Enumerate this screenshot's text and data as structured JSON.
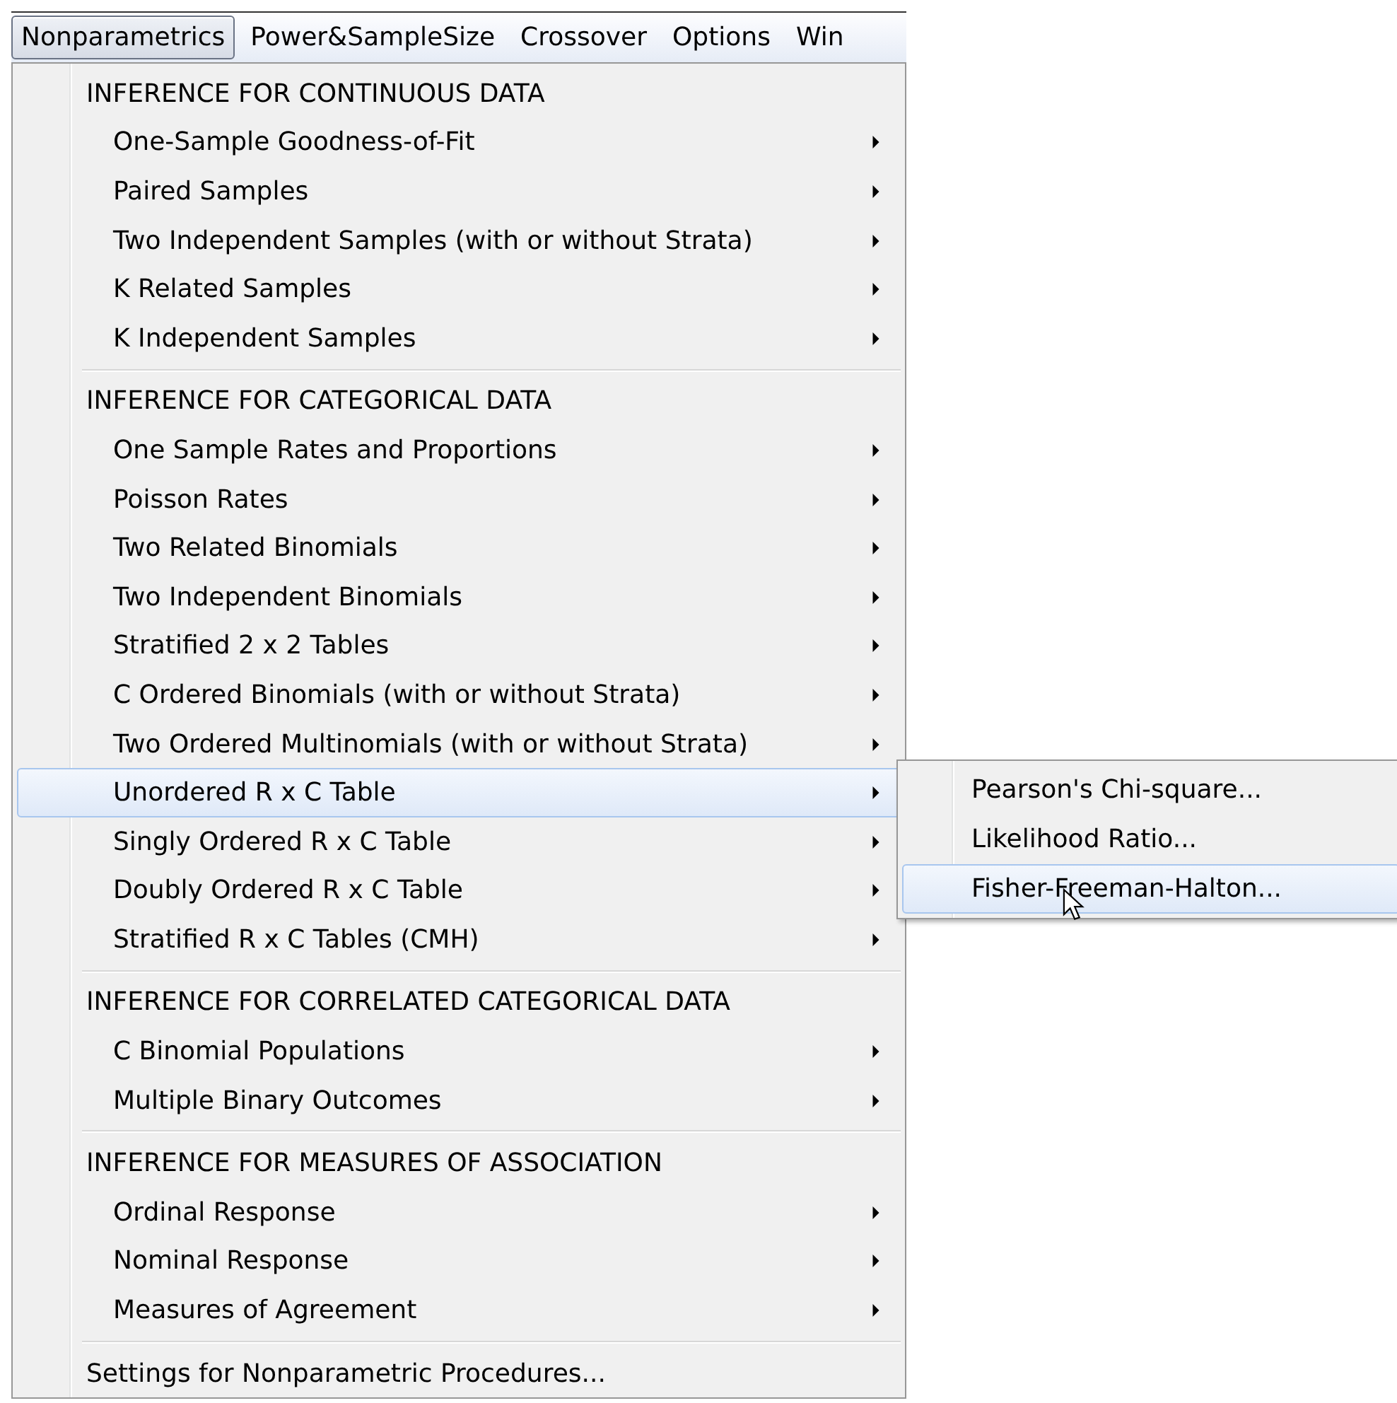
{
  "menubar": [
    {
      "label": "Nonparametrics",
      "selected": true
    },
    {
      "label": "Power&SampleSize",
      "selected": false
    },
    {
      "label": "Crossover",
      "selected": false
    },
    {
      "label": "Options",
      "selected": false
    },
    {
      "label": "Win",
      "selected": false
    }
  ],
  "menu": {
    "sections": [
      {
        "header": "INFERENCE FOR CONTINUOUS DATA",
        "items": [
          {
            "label": "One-Sample Goodness-of-Fit",
            "submenu": true,
            "selected": false
          },
          {
            "label": "Paired Samples",
            "submenu": true,
            "selected": false
          },
          {
            "label": "Two Independent Samples (with or without Strata)",
            "submenu": true,
            "selected": false
          },
          {
            "label": "K Related Samples",
            "submenu": true,
            "selected": false
          },
          {
            "label": "K Independent Samples",
            "submenu": true,
            "selected": false
          }
        ]
      },
      {
        "header": "INFERENCE FOR CATEGORICAL DATA",
        "items": [
          {
            "label": "One Sample Rates and Proportions",
            "submenu": true,
            "selected": false
          },
          {
            "label": "Poisson Rates",
            "submenu": true,
            "selected": false
          },
          {
            "label": "Two Related Binomials",
            "submenu": true,
            "selected": false
          },
          {
            "label": "Two Independent Binomials",
            "submenu": true,
            "selected": false
          },
          {
            "label": "Stratified 2 x 2 Tables",
            "submenu": true,
            "selected": false
          },
          {
            "label": "C Ordered Binomials (with or without Strata)",
            "submenu": true,
            "selected": false
          },
          {
            "label": "Two Ordered Multinomials (with or without Strata)",
            "submenu": true,
            "selected": false
          },
          {
            "label": "Unordered R x C Table",
            "submenu": true,
            "selected": true
          },
          {
            "label": "Singly Ordered R x C Table",
            "submenu": true,
            "selected": false
          },
          {
            "label": "Doubly Ordered R x C Table",
            "submenu": true,
            "selected": false
          },
          {
            "label": "Stratified R x C Tables (CMH)",
            "submenu": true,
            "selected": false
          }
        ]
      },
      {
        "header": "INFERENCE FOR CORRELATED CATEGORICAL DATA",
        "items": [
          {
            "label": "C Binomial Populations",
            "submenu": true,
            "selected": false
          },
          {
            "label": "Multiple Binary Outcomes",
            "submenu": true,
            "selected": false
          }
        ]
      },
      {
        "header": "INFERENCE FOR MEASURES OF ASSOCIATION",
        "items": [
          {
            "label": "Ordinal Response",
            "submenu": true,
            "selected": false
          },
          {
            "label": "Nominal Response",
            "submenu": true,
            "selected": false
          },
          {
            "label": "Measures of Agreement",
            "submenu": true,
            "selected": false
          }
        ]
      }
    ],
    "footer_item": {
      "label": "Settings for Nonparametric Procedures..."
    }
  },
  "submenu": {
    "items": [
      {
        "label": "Pearson's Chi-square...",
        "selected": false
      },
      {
        "label": "Likelihood Ratio...",
        "selected": false
      },
      {
        "label": "Fisher-Freeman-Halton...",
        "selected": true
      }
    ]
  }
}
